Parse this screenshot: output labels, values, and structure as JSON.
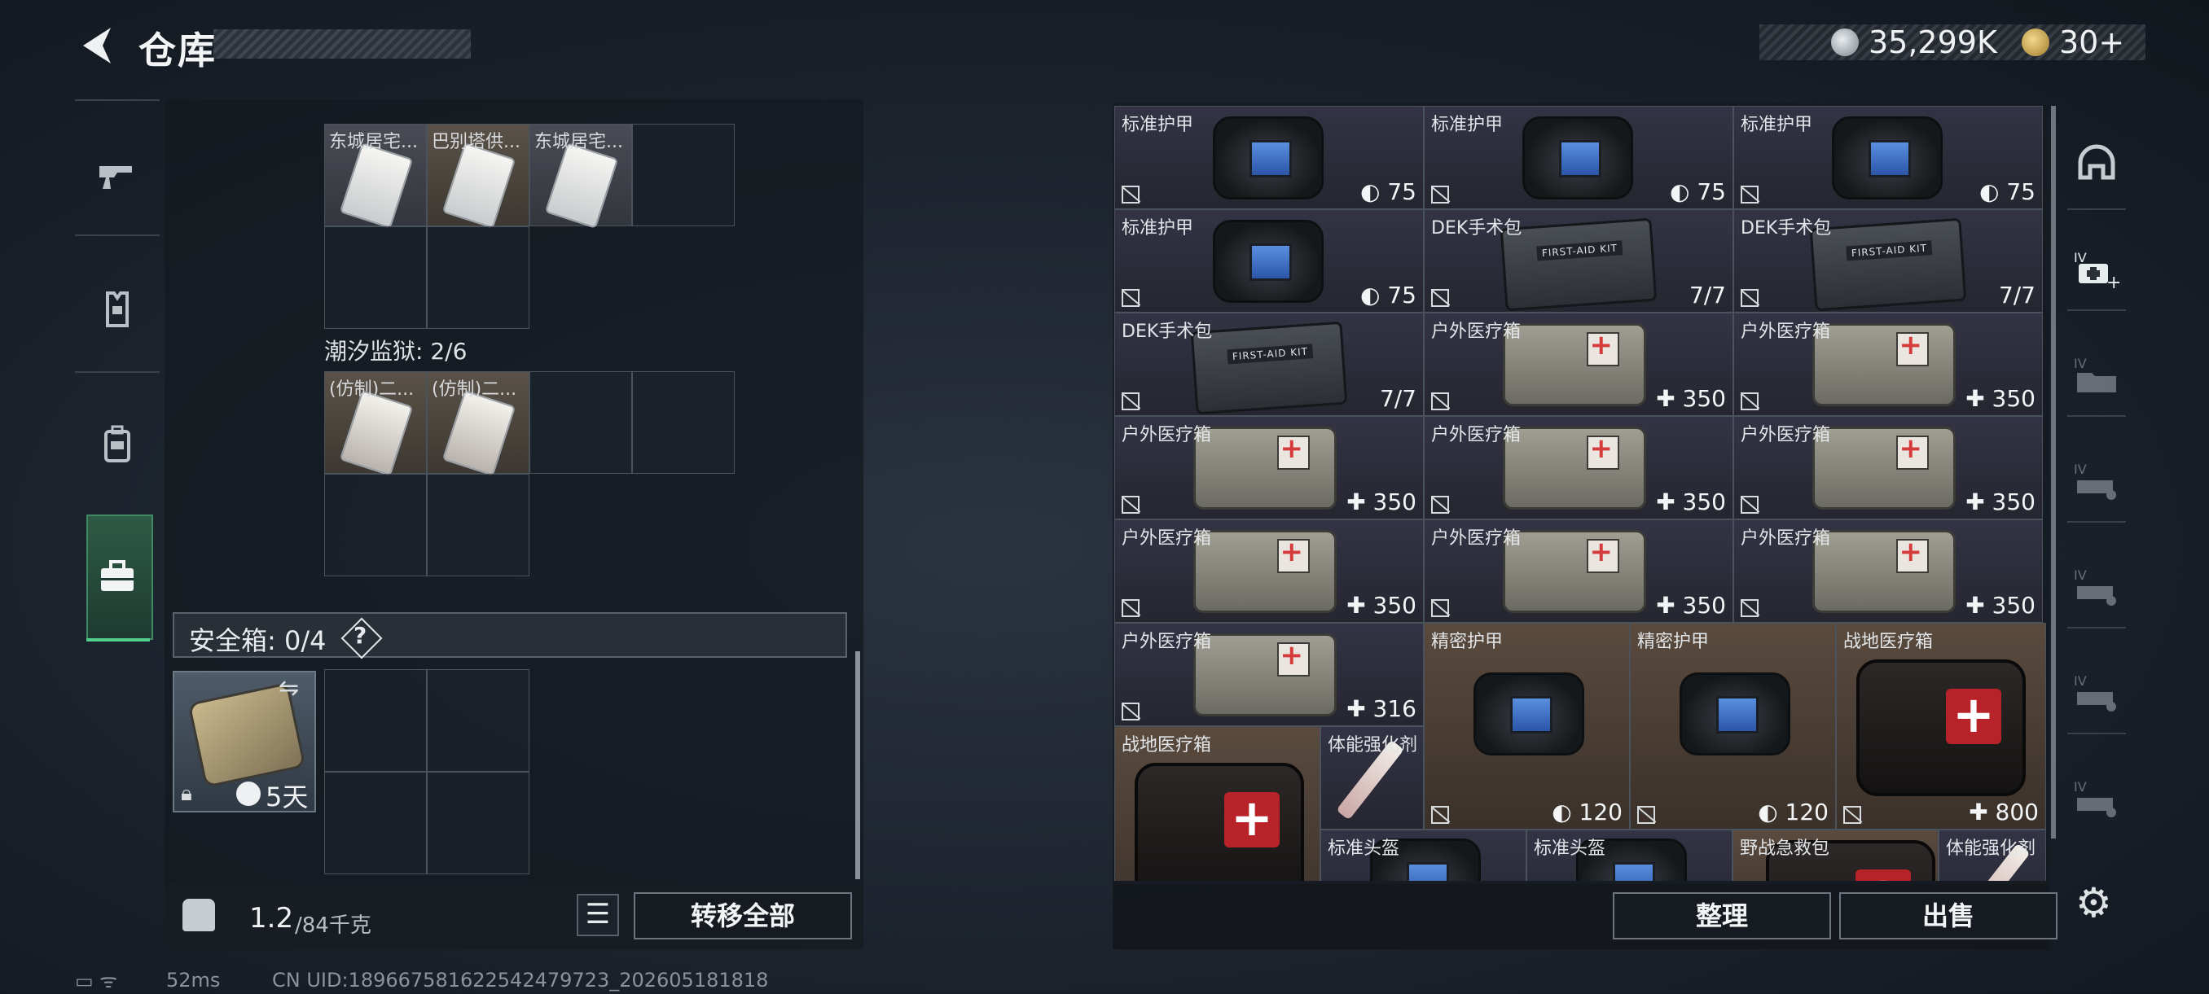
{
  "header": {
    "title": "仓库",
    "currency_primary": "35,299K",
    "currency_secondary": "30+"
  },
  "left_nav": {
    "items": [
      {
        "name": "weapons",
        "icon": "gun-icon"
      },
      {
        "name": "equipment",
        "icon": "vest-icon"
      },
      {
        "name": "backpack",
        "icon": "backpack-icon"
      },
      {
        "name": "medical",
        "icon": "briefcase-icon",
        "active": true
      }
    ]
  },
  "collections": {
    "group1_items": [
      {
        "label": "东城居宅..."
      },
      {
        "label": "巴别塔供..."
      },
      {
        "label": "东城居宅..."
      }
    ],
    "group2_title": "潮汐监狱: 2/6",
    "group2_items": [
      {
        "label": "(仿制)二..."
      },
      {
        "label": "(仿制)二..."
      }
    ]
  },
  "safebox": {
    "label": "安全箱: 0/4",
    "help": "?",
    "days": "5天"
  },
  "bottom_left": {
    "weight": "1.2",
    "weight_max": "/84千克",
    "transfer_all": "转移全部"
  },
  "status": {
    "ping": "52ms",
    "uid": "CN UID:1896675816225424797​23_202605181818"
  },
  "stash": {
    "rows": [
      [
        {
          "name": "标准护甲",
          "value": "75",
          "type": "armor"
        },
        {
          "name": "标准护甲",
          "value": "75",
          "type": "armor"
        },
        {
          "name": "标准护甲",
          "value": "75",
          "type": "armor"
        }
      ],
      [
        {
          "name": "标准护甲",
          "value": "75",
          "type": "armor"
        },
        {
          "name": "DEK手术包",
          "value": "7/7",
          "type": "kit"
        },
        {
          "name": "DEK手术包",
          "value": "7/7",
          "type": "kit"
        }
      ],
      [
        {
          "name": "DEK手术包",
          "value": "7/7",
          "type": "kit"
        },
        {
          "name": "户外医疗箱",
          "value": "350",
          "type": "medbox"
        },
        {
          "name": "户外医疗箱",
          "value": "350",
          "type": "medbox"
        }
      ],
      [
        {
          "name": "户外医疗箱",
          "value": "350",
          "type": "medbox"
        },
        {
          "name": "户外医疗箱",
          "value": "350",
          "type": "medbox"
        },
        {
          "name": "户外医疗箱",
          "value": "350",
          "type": "medbox"
        }
      ],
      [
        {
          "name": "户外医疗箱",
          "value": "350",
          "type": "medbox"
        },
        {
          "name": "户外医疗箱",
          "value": "350",
          "type": "medbox"
        },
        {
          "name": "户外医疗箱",
          "value": "350",
          "type": "medbox"
        }
      ]
    ],
    "row6": [
      {
        "name": "户外医疗箱",
        "value": "316"
      },
      {
        "name": "精密护甲",
        "value": "120"
      },
      {
        "name": "精密护甲",
        "value": "120"
      },
      {
        "name": "战地医疗箱",
        "value": "800"
      }
    ],
    "row7": [
      {
        "name": "战地医疗箱"
      },
      {
        "name": "体能强化剂"
      },
      {
        "name": "标准头盔"
      },
      {
        "name": "标准头盔"
      },
      {
        "name": "野战急救包"
      },
      {
        "name": "体能强化剂"
      }
    ],
    "sort": "整理",
    "sell": "出售"
  },
  "right_nav": {
    "items": [
      "helmet-icon",
      "medkit-plus-icon",
      "folder-icon",
      "vehicle-icon",
      "vehicle-icon",
      "vehicle-icon",
      "vehicle-icon"
    ]
  }
}
